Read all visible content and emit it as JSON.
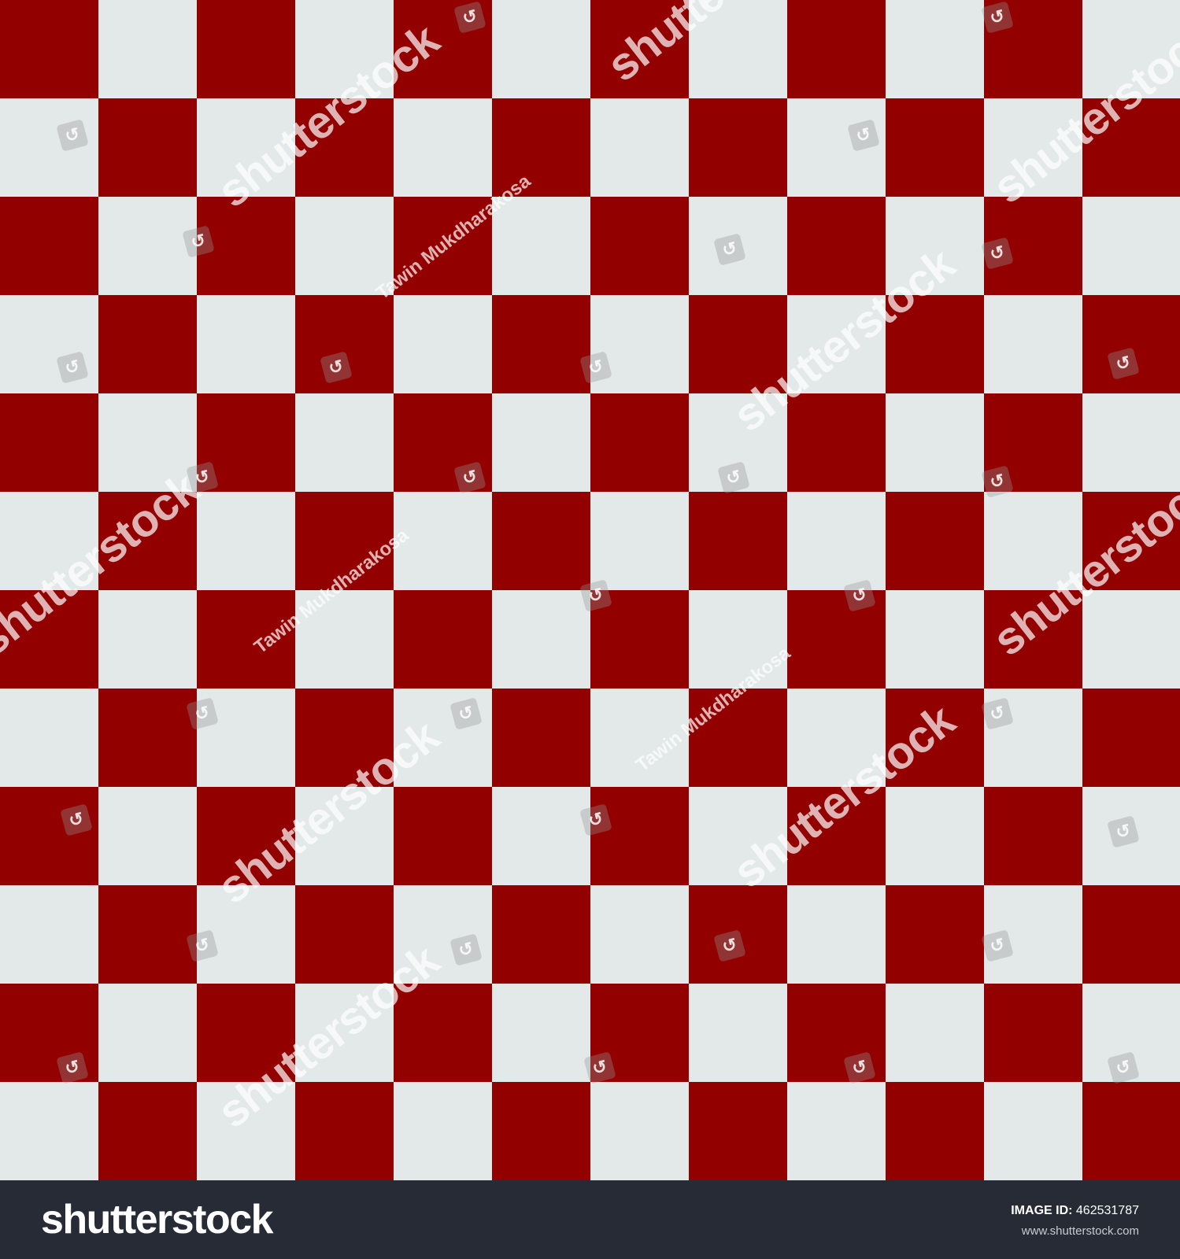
{
  "board": {
    "rows": 12,
    "cols": 12,
    "dark_color": "#930000",
    "light_color": "#e3e8e8",
    "top_left": "dark"
  },
  "watermarks": {
    "brand": "shutterstock",
    "author": "Tawin Mukdharakosa"
  },
  "footer": {
    "logo": "shutterstock",
    "image_id_label": "IMAGE ID:",
    "image_id": "462531787",
    "url": "www.shutterstock.com"
  }
}
